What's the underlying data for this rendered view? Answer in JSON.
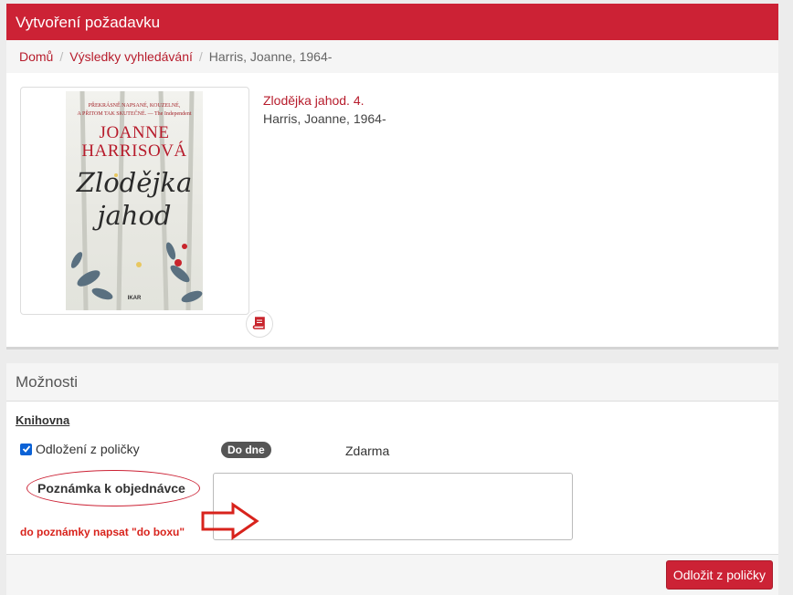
{
  "header": {
    "title": "Vytvoření požadavku"
  },
  "breadcrumb": {
    "home": "Domů",
    "results": "Výsledky vyhledávání",
    "current": "Harris, Joanne, 1964-"
  },
  "record": {
    "title": "Zlodějka jahod. 4.",
    "author": "Harris, Joanne, 1964-",
    "cover": {
      "tagline_line1": "PŘEKRÁSNĚ NAPSANÉ, KOUZELNÉ,",
      "tagline_line2": "A PŘITOM TAK SKUTEČNÉ. — The Independent",
      "author_line1": "JOANNE",
      "author_line2": "HARRISOVÁ",
      "title_line1": "Zlodějka",
      "title_line2": "jahod",
      "publisher": "IKAR"
    },
    "badge_icon": "book-icon"
  },
  "options": {
    "heading": "Možnosti",
    "library_heading": "Knihovna",
    "pickup_option": "Odložení z poličky",
    "pickup_checked": true,
    "due_badge": "Do dne",
    "price": "Zdarma",
    "note_label": "Poznámka k objednávce",
    "note_value": "",
    "annotation_hint": "do poznámky napsat \"do boxu\"",
    "submit_label": "Odložit z poličky"
  },
  "colors": {
    "accent": "#cc2235",
    "annotation": "#d8231c",
    "checkbox": "#0b62d6"
  }
}
